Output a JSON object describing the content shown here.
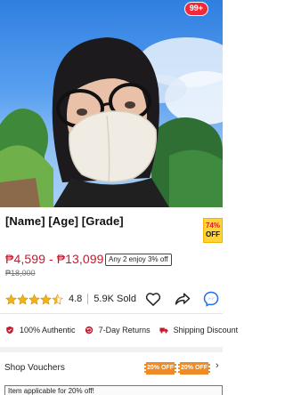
{
  "header": {
    "cart_badge": "99+"
  },
  "product": {
    "title": "[Name]  [Age]  [Grade]",
    "discount_badge": {
      "percent": "74%",
      "label": "OFF"
    },
    "price_range": "₱4,599 - ₱13,099",
    "promo_tag": "Any 2 enjoy 3% off",
    "original_price": "₱18,000",
    "rating": {
      "value": "4.8",
      "stars": 4.5,
      "max": 5
    },
    "sold": "5.9K Sold"
  },
  "guarantees": [
    {
      "icon": "shield-icon",
      "label": "100% Authentic"
    },
    {
      "icon": "return-icon",
      "label": "7-Day Returns"
    },
    {
      "icon": "truck-icon",
      "label": "Shipping Discount"
    }
  ],
  "vouchers": {
    "title": "Shop Vouchers",
    "chips": [
      "20% OFF",
      "20% OFF"
    ],
    "applicable_text": "Item applicable for 20% off!"
  },
  "colors": {
    "accent": "#c7192d",
    "badge": "#ee2b39",
    "voucher": "#f08a24",
    "star": "#f3b312"
  }
}
